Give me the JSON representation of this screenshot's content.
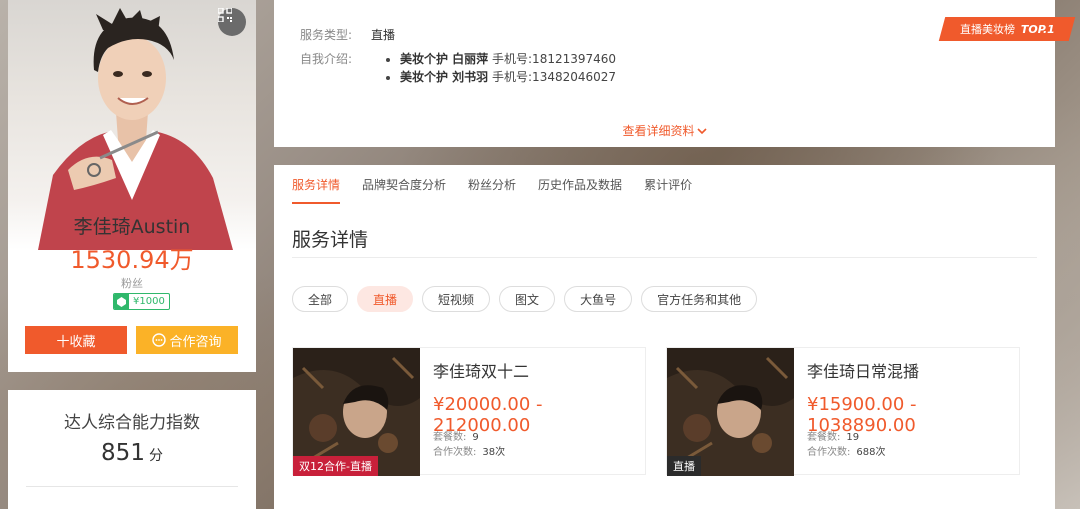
{
  "profile": {
    "name": "李佳琦Austin",
    "fans_count": "1530.94万",
    "fans_label": "粉丝",
    "price_badge": "¥1000",
    "collect_button": "十收藏",
    "consult_button": "合作咨询"
  },
  "ability": {
    "title": "达人综合能力指数",
    "score": "851",
    "unit": "分"
  },
  "intro": {
    "service_type_label": "服务类型:",
    "service_type_value": "直播",
    "self_intro_label": "自我介绍:",
    "contacts": [
      {
        "role_name": "美妆个护 白丽萍",
        "phone": "手机号:18121397460"
      },
      {
        "role_name": "美妆个护 刘书羽",
        "phone": "手机号:13482046027"
      }
    ],
    "rank_tag_label": "直播美妆榜",
    "rank_tag_top": "TOP.1",
    "more_link": "查看详细资料"
  },
  "detail": {
    "tabs": [
      "服务详情",
      "品牌契合度分析",
      "粉丝分析",
      "历史作品及数据",
      "累计评价"
    ],
    "active_tab": 0,
    "section_title": "服务详情",
    "filters": [
      "全部",
      "直播",
      "短视频",
      "图文",
      "大鱼号",
      "官方任务和其他"
    ],
    "active_filter": 1,
    "packages": [
      {
        "title": "李佳琦双十二",
        "price": "¥20000.00 - 212000.00",
        "package_count_label": "套餐数:",
        "package_count": "9",
        "coop_label": "合作次数:",
        "coop_count": "38次",
        "tag": "双12合作-直播",
        "tag_color": "#c8203a"
      },
      {
        "title": "李佳琦日常混播",
        "price": "¥15900.00 - 1038890.00",
        "package_count_label": "套餐数:",
        "package_count": "19",
        "coop_label": "合作次数:",
        "coop_count": "688次",
        "tag": "直播",
        "tag_color": "#2b2b2b"
      }
    ]
  },
  "colors": {
    "accent": "#f05a2c",
    "consult": "#fbb227",
    "badge_green": "#2fb86b"
  },
  "icons": {
    "qr": "qr-code-icon",
    "chevron": "chevron-down-icon",
    "chat": "chat-bubble-icon"
  }
}
